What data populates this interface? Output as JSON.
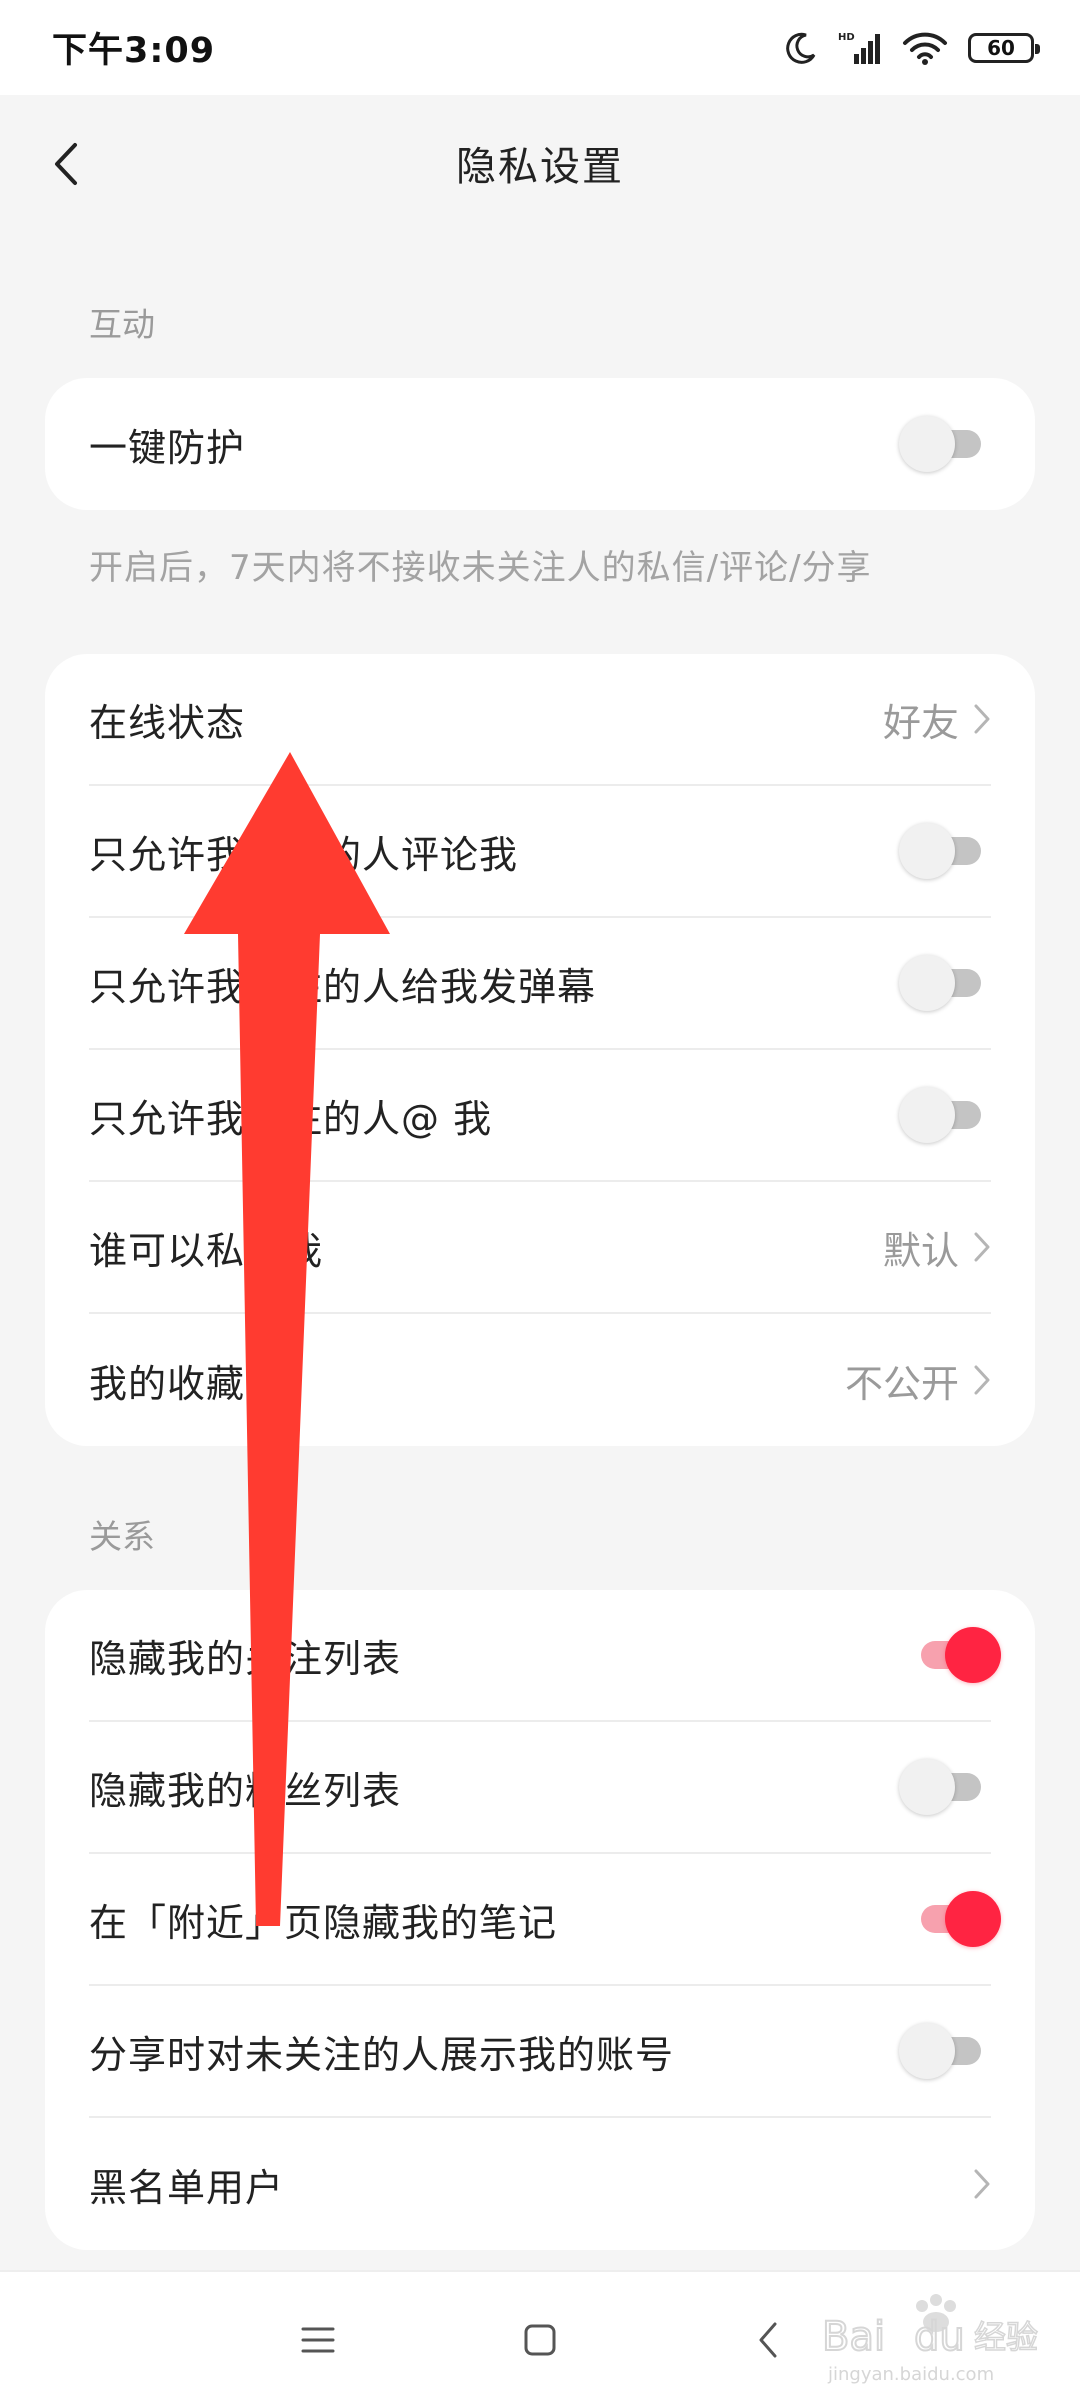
{
  "status_bar": {
    "time": "下午3:09",
    "battery": "60"
  },
  "header": {
    "title": "隐私设置"
  },
  "interaction": {
    "section_title": "互动",
    "protect_label": "一键防护",
    "protect_on": false,
    "hint": "开启后，7天内将不接收未关注人的私信/评论/分享",
    "items": [
      {
        "label": "在线状态",
        "type": "link",
        "value": "好友"
      },
      {
        "label": "只允许我关注的人评论我",
        "type": "toggle",
        "on": false
      },
      {
        "label": "只允许我关注的人给我发弹幕",
        "type": "toggle",
        "on": false
      },
      {
        "label": "只允许我关注的人@ 我",
        "type": "toggle",
        "on": false
      },
      {
        "label": "谁可以私信我",
        "type": "link",
        "value": "默认"
      },
      {
        "label": "我的收藏",
        "type": "link",
        "value": "不公开"
      }
    ]
  },
  "relations": {
    "section_title": "关系",
    "items": [
      {
        "label": "隐藏我的关注列表",
        "type": "toggle",
        "on": true
      },
      {
        "label": "隐藏我的粉丝列表",
        "type": "toggle",
        "on": false
      },
      {
        "label": "在「附近」页隐藏我的笔记",
        "type": "toggle",
        "on": true
      },
      {
        "label": "分享时对未关注的人展示我的账号",
        "type": "toggle",
        "on": false
      },
      {
        "label": "黑名单用户",
        "type": "link",
        "value": ""
      }
    ]
  },
  "watermark": {
    "brand": "Bai du 经验",
    "url": "jingyan.baidu.com"
  },
  "colors": {
    "accent": "#ff2442",
    "toggle_on_track": "#f7a1ae",
    "toggle_off_track": "#c4c4c4",
    "arrow": "#ff3b30"
  },
  "icons": {
    "back": "chevron-left-icon",
    "row_link": "chevron-right-icon",
    "moon": "moon-icon",
    "signal": "signal-icon",
    "wifi": "wifi-icon",
    "nav_menu": "menu-icon",
    "nav_home": "square-icon",
    "nav_back": "back-icon"
  }
}
